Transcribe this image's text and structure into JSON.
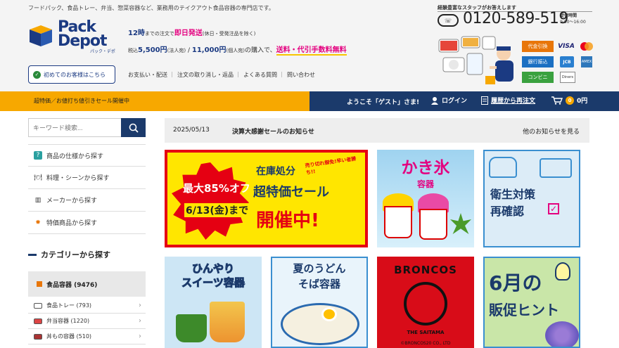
{
  "header": {
    "tagline": "フードパック、食品トレー、弁当、惣菜容器など、業務用のテイクアウト食品容器の専門店です。",
    "logo_line1": "Pack",
    "logo_line2": "Depot",
    "logo_kana": "パック・デポ",
    "first_time_button": "初めてのお客様はこちら",
    "shipping_line1": {
      "prefix": "12時",
      "mid": "までの注文で",
      "highlight": "即日発送",
      "note": "(休日・受発注品を除く)"
    },
    "shipping_line2": {
      "prefix": "税込",
      "amount1": "5,500円",
      "unit1": "(法人宛)",
      "sep": " / ",
      "amount2": "11,000円",
      "unit2": "(個人宛)",
      "mid": "の購入で、",
      "highlight": "送料・代引手数料無料"
    },
    "nav": [
      "お支払い・配送",
      "注文の取り消し・返品",
      "よくある質問",
      "問い合わせ"
    ],
    "phone_note": "経験豊富なスタッフがお答えします",
    "phone_icon": "free dial",
    "phone_number": "0120-589-519",
    "hours_label": "受付時間",
    "hours": "9:00～16:00",
    "payments": {
      "cash_on_delivery": "代金引換",
      "visa": "VISA",
      "bank_transfer": "銀行振込",
      "jcb": "JCB",
      "amex": "AMEX",
      "convenience_store": "コンビニ",
      "diners": "Diners"
    }
  },
  "bar": {
    "promo": "超特価／お値打ち値引きセール開催中",
    "welcome": "ようこそ「ゲスト」さま!",
    "login": "ログイン",
    "reorder": "履歴から再注文",
    "cart_count": "0",
    "cart_total": "0円"
  },
  "sidebar": {
    "search_placeholder": "キーワード検索...",
    "links": [
      {
        "label": "商品の仕様から探す",
        "icon": "spec-icon"
      },
      {
        "label": "料理・シーンから探す",
        "icon": "dish-icon"
      },
      {
        "label": "メーカーから探す",
        "icon": "factory-icon"
      },
      {
        "label": "特価商品から探す",
        "icon": "sale-icon"
      }
    ],
    "category_heading": "カテゴリーから探す",
    "main_category": "食品容器 (9476)",
    "subcategories": [
      {
        "label": "食品トレー (793)"
      },
      {
        "label": "弁当容器 (1220)"
      },
      {
        "label": "丼もの容器 (510)"
      }
    ]
  },
  "news": {
    "date": "2025/05/13",
    "title": "決算大感謝セールのお知らせ",
    "more": "他のお知らせを見る"
  },
  "banners": {
    "sale": {
      "max": "最大85%オフ",
      "date": "6/13(金)まで",
      "sold_out": "売り切れ御免!早い者勝ち!!",
      "stock": "在庫処分",
      "sale": "超特価セール",
      "now": "開催中!"
    },
    "kakigori": {
      "title": "かき氷",
      "sub": "容器"
    },
    "hygiene": {
      "line1": "衛生対策",
      "line2": "再確認"
    },
    "sweets": {
      "line1": "ひんやり",
      "line2": "スイーツ容器"
    },
    "udon": {
      "line1": "夏のうどん",
      "line2": "そば容器"
    },
    "broncos": {
      "name": "BRONCOS",
      "sub": "THE SAITAMA",
      "copy": "©BRONCOS20 CO., LTD"
    },
    "june": {
      "line1": "6月の",
      "line2": "販促ヒント"
    }
  },
  "colors": {
    "navy": "#1b3a6b",
    "orange": "#f7a800",
    "pink": "#e4007f",
    "red": "#e50012"
  }
}
